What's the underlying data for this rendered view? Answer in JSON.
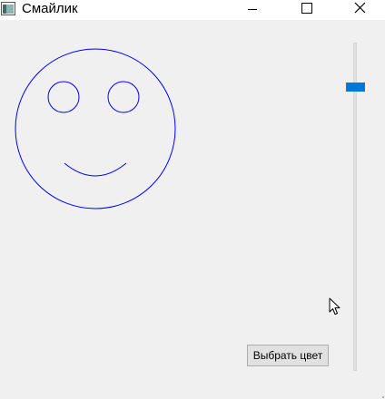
{
  "window": {
    "title": "Смайлик",
    "icon": "window-app-icon",
    "controls": [
      "minimize-icon",
      "maximize-icon",
      "close-icon"
    ]
  },
  "smiley": {
    "stroke_color": "#0000ff"
  },
  "slider": {
    "orientation": "vertical",
    "value_fraction": 0.13,
    "accent_color": "#0078d7"
  },
  "color_button": {
    "label": "Выбрать цвет"
  }
}
